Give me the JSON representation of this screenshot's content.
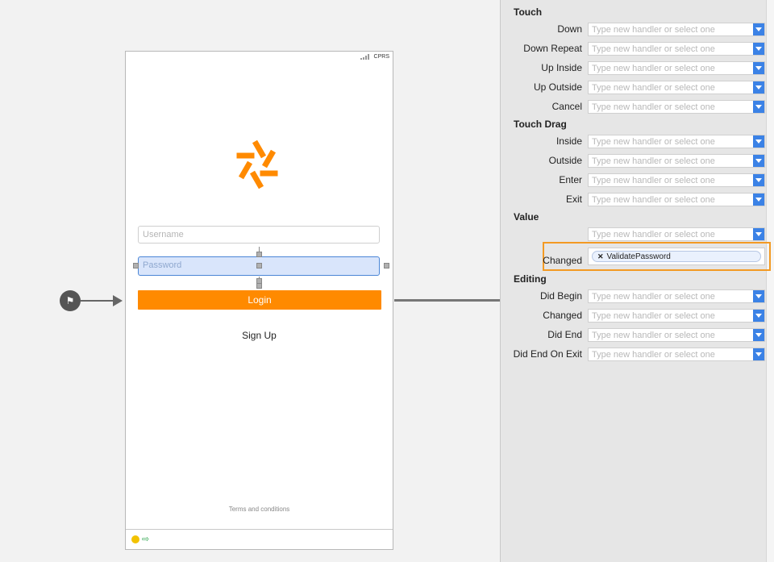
{
  "canvas": {
    "entry_icon": "flag-icon",
    "phone": {
      "status": {
        "carrier": "CPRS"
      },
      "username_placeholder": "Username",
      "password_placeholder": "Password",
      "login_label": "Login",
      "signup_label": "Sign Up",
      "terms_label": "Terms and conditions"
    },
    "colors": {
      "accent": "#ff8a00",
      "selection": "#4b86d6"
    }
  },
  "events": {
    "placeholder": "Type new handler or select one",
    "sections": {
      "touch": {
        "title": "Touch",
        "rows": [
          "Down",
          "Down Repeat",
          "Up Inside",
          "Up Outside",
          "Cancel"
        ]
      },
      "touch_drag": {
        "title": "Touch Drag",
        "rows": [
          "Inside",
          "Outside",
          "Enter",
          "Exit"
        ]
      },
      "value": {
        "title": "Value",
        "changed_label": "Changed",
        "changed_handler": "ValidatePassword"
      },
      "editing": {
        "title": "Editing",
        "rows": [
          "Did Begin",
          "Changed",
          "Did End",
          "Did End On Exit"
        ]
      }
    }
  }
}
